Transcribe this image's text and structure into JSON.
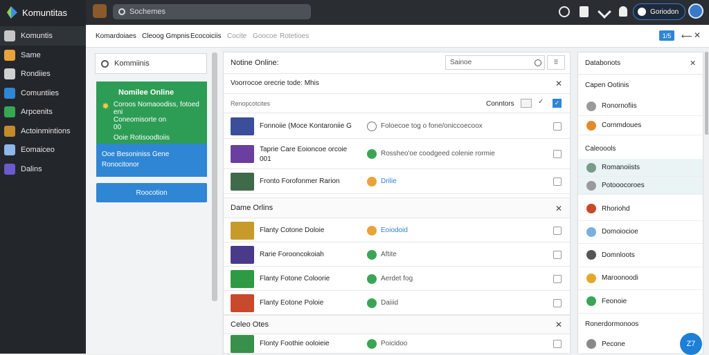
{
  "app": {
    "title": "Komuntitas"
  },
  "search": {
    "placeholder": "Sochemes"
  },
  "user": {
    "button_label": "Goriodon"
  },
  "sidebar": {
    "items": [
      {
        "label": "Komuntis",
        "color": "#c7c7c7"
      },
      {
        "label": "Same",
        "color": "#e8a33b"
      },
      {
        "label": "Rondiies",
        "color": "#d0d0d0"
      },
      {
        "label": "Comuntiies",
        "color": "#2f86d4"
      },
      {
        "label": "Arpcenits",
        "color": "#35a853"
      },
      {
        "label": "Actoinmintions",
        "color": "#c48a2e"
      },
      {
        "label": "Eomaiceo",
        "color": "#8fb7e8"
      },
      {
        "label": "Dalins",
        "color": "#6a5acd"
      }
    ]
  },
  "subnav": {
    "links": [
      "Komardoiaes",
      "Cleoog Gmpnis",
      "Ecocoiciis",
      "Cocite",
      "Goocoe",
      "Rotetioes"
    ],
    "badge": "1/5"
  },
  "left": {
    "search_placeholder": "Kommiinis",
    "green_card": {
      "title": "Nomilee Online",
      "line1": "Coroos Nomaoodiss, fotoed eni",
      "line2": "Coneomisorte on",
      "line3": "00",
      "line4": "Ooie Rotisoodtoiis"
    },
    "blue_card": {
      "line1": "Ooe Besoniniss Gene",
      "line2": "Ronocitonor"
    },
    "button": "Roocotion"
  },
  "main": {
    "header_title": "Notine Online:",
    "search_placeholder": "Sainoe",
    "filter_text": "Voorrocoe orecrie tode: Mhis",
    "group_label": "Renopcotcites",
    "sort_label": "Conntors",
    "sections": [
      "Dame Orlins",
      "Celeo Otes"
    ],
    "rows": [
      {
        "title": "Fonnoiie (Moce Kontaroniie G",
        "title2": "",
        "status": "Foloecoe tog o fone/oniccoecoox",
        "status_kind": "pending",
        "thumb": "#3a4e9a"
      },
      {
        "title": "Taprie Care Eoioncoe orcoie",
        "title2": "001",
        "status": "Rossheo'oe coodgeed colenie rormie",
        "status_kind": "ok",
        "thumb": "#6b3fa0"
      },
      {
        "title": "Fronto Forofonmer Rarion",
        "title2": "",
        "status": "Drilie",
        "status_kind": "warn",
        "thumb": "#3f6b4a"
      },
      {
        "title": "Flanty Cotone Doloie",
        "title2": "",
        "status": "Eoiodoid",
        "status_kind": "warn",
        "thumb": "#c89a2a"
      },
      {
        "title": "Rarie Forooncokoiah",
        "title2": "",
        "status": "Aftite",
        "status_kind": "ok",
        "thumb": "#4a3a8a"
      },
      {
        "title": "Flanty Fotone Coloorie",
        "title2": "",
        "status": "Aerdet fog",
        "status_kind": "ok",
        "thumb": "#2e9a44"
      },
      {
        "title": "Flanty Eotone Poloie",
        "title2": "",
        "status": "Daiiid",
        "status_kind": "ok",
        "thumb": "#c8492c"
      },
      {
        "title": "Flonty Foothie ooloieie",
        "title2": "",
        "status": "Poicidoo",
        "status_kind": "ok",
        "thumb": "#38904a"
      }
    ]
  },
  "right": {
    "title": "Databonots",
    "section1": "Capen Ootinis",
    "items1": [
      "Ronornofiis",
      "Cornmdoues"
    ],
    "section2": "Caleoools",
    "items2": [
      "Romanoiists",
      "Potooocoroes"
    ],
    "items3": [
      "Rhoriohd",
      "Domoiocioe",
      "Domnloots",
      "Maroonoodi",
      "Feonoie"
    ],
    "section3": "Ronerdormonoos",
    "items4": [
      "Pecone"
    ],
    "fab": "Z7"
  }
}
